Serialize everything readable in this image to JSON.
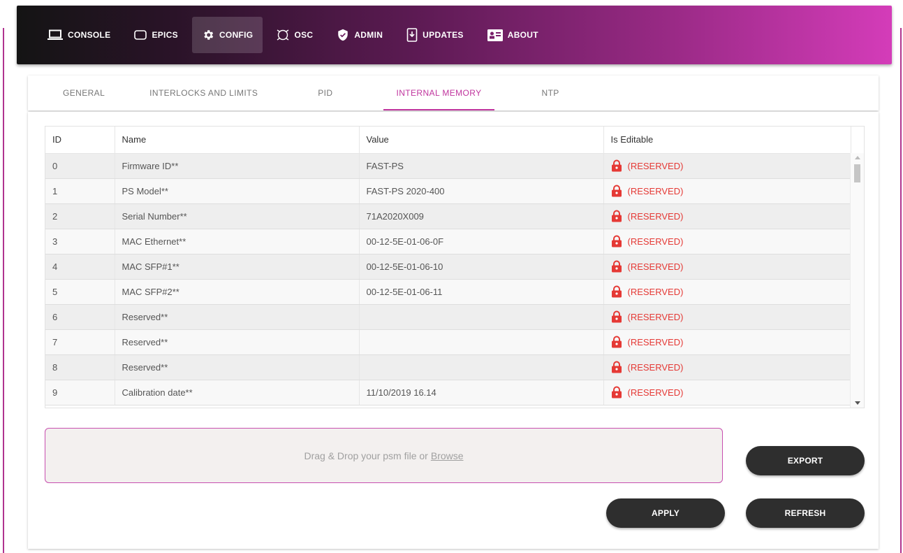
{
  "nav": {
    "items": [
      {
        "label": "CONSOLE",
        "icon": "laptop-icon"
      },
      {
        "label": "EPICS",
        "icon": "rounded-square-icon"
      },
      {
        "label": "CONFIG",
        "icon": "gear-icon",
        "active": true
      },
      {
        "label": "OSC",
        "icon": "oscilloscope-icon"
      },
      {
        "label": "ADMIN",
        "icon": "shield-check-icon"
      },
      {
        "label": "UPDATES",
        "icon": "device-download-icon"
      },
      {
        "label": "ABOUT",
        "icon": "id-card-icon"
      }
    ]
  },
  "tabs": [
    {
      "label": "GENERAL"
    },
    {
      "label": "INTERLOCKS AND LIMITS"
    },
    {
      "label": "PID"
    },
    {
      "label": "INTERNAL MEMORY",
      "active": true
    },
    {
      "label": "NTP"
    }
  ],
  "table": {
    "headers": [
      "ID",
      "Name",
      "Value",
      "Is Editable"
    ],
    "rows": [
      {
        "id": "0",
        "name": "Firmware ID**",
        "value": "FAST-PS",
        "editable": "(RESERVED)"
      },
      {
        "id": "1",
        "name": "PS Model**",
        "value": "FAST-PS 2020-400",
        "editable": "(RESERVED)"
      },
      {
        "id": "2",
        "name": "Serial Number**",
        "value": "71A2020X009",
        "editable": "(RESERVED)"
      },
      {
        "id": "3",
        "name": "MAC Ethernet**",
        "value": "00-12-5E-01-06-0F",
        "editable": "(RESERVED)"
      },
      {
        "id": "4",
        "name": "MAC SFP#1**",
        "value": "00-12-5E-01-06-10",
        "editable": "(RESERVED)"
      },
      {
        "id": "5",
        "name": "MAC SFP#2**",
        "value": "00-12-5E-01-06-11",
        "editable": "(RESERVED)"
      },
      {
        "id": "6",
        "name": "Reserved**",
        "value": "",
        "editable": "(RESERVED)"
      },
      {
        "id": "7",
        "name": "Reserved**",
        "value": "",
        "editable": "(RESERVED)"
      },
      {
        "id": "8",
        "name": "Reserved**",
        "value": "",
        "editable": "(RESERVED)"
      },
      {
        "id": "9",
        "name": "Calibration date**",
        "value": "11/10/2019 16.14",
        "editable": "(RESERVED)"
      }
    ]
  },
  "dropzone": {
    "text": "Drag & Drop your psm file or",
    "link": "Browse"
  },
  "buttons": {
    "export": "EXPORT",
    "apply": "APPLY",
    "refresh": "REFRESH"
  },
  "colors": {
    "accent": "#c0359e",
    "reserved": "#e53935",
    "button": "#2e2e2e"
  }
}
